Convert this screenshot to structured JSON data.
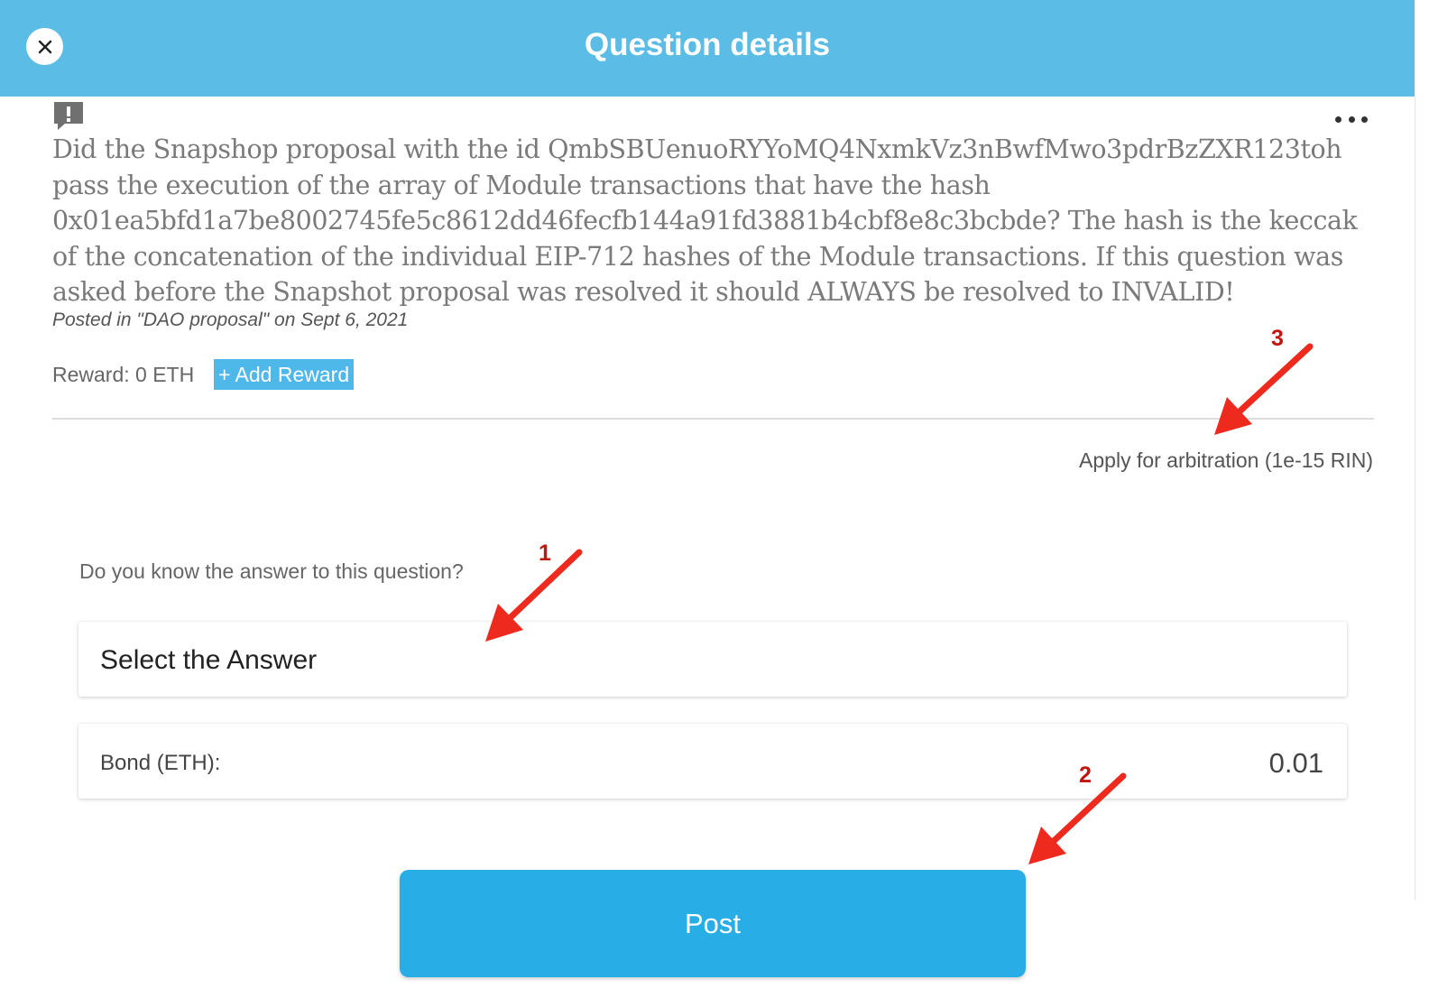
{
  "header": {
    "title": "Question details",
    "close_icon": "close-icon"
  },
  "question": {
    "text": "Did the Snapshop proposal with the id QmbSBUenuoRYYoMQ4NxmkVz3nBwfMwo3pdrBzZXR123toh pass the execution of the array of Module transactions that have the hash 0x01ea5bfd1a7be8002745fe5c8612dd46fecfb144a91fd3881b4cbf8e8c3bcbde? The hash is the keccak of the concatenation of the individual EIP-712 hashes of the Module transactions. If this question was asked before the Snapshot proposal was resolved it should ALWAYS be resolved to INVALID!",
    "posted": "Posted in \"DAO proposal\" on Sept 6, 2021",
    "flag_icon": "report-flag-icon",
    "more_icon": "more-horizontal-icon"
  },
  "reward": {
    "label": "Reward: 0 ETH",
    "add_button": "+ Add Reward"
  },
  "arbitration": {
    "label": "Apply for arbitration (1e-15 RIN)"
  },
  "answer_form": {
    "prompt": "Do you know the answer to this question?",
    "select_placeholder": "Select the Answer",
    "bond_label": "Bond (ETH):",
    "bond_value": "0.01",
    "post_button": "Post"
  },
  "annotations": {
    "num_1": "1",
    "num_2": "2",
    "num_3": "3",
    "arrow_color": "#ee2a1e",
    "number_color": "#c0160f"
  },
  "colors": {
    "header_bg": "#5bbde6",
    "post_button_bg": "#29ade6",
    "add_reward_bg": "#4fb8ea"
  }
}
